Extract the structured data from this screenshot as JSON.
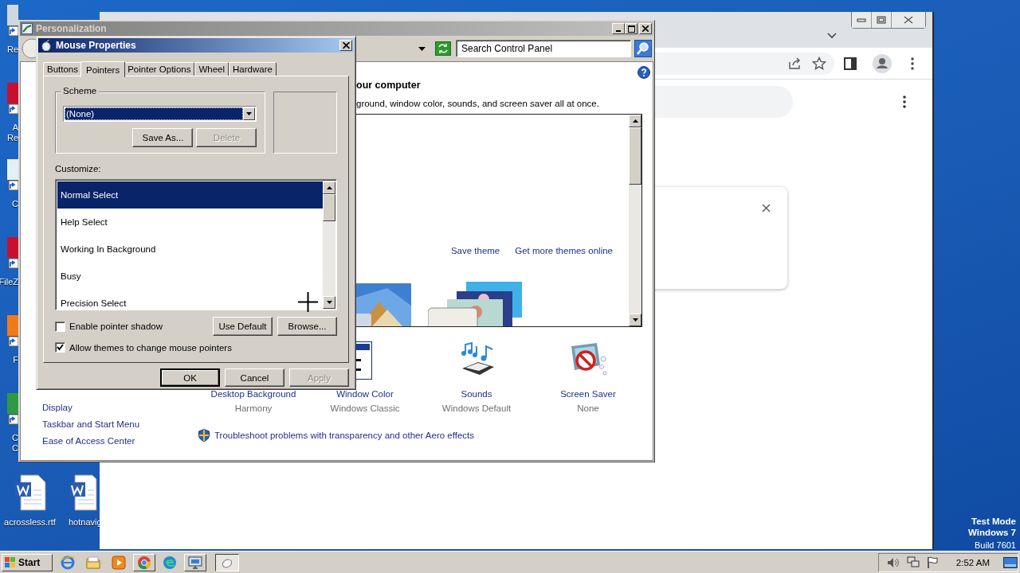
{
  "desktop_icons": [
    {
      "kind": "bin",
      "label": "Re"
    },
    {
      "kind": "app",
      "label": "A\nRe"
    },
    {
      "kind": "plain",
      "label": "C"
    },
    {
      "kind": "app",
      "label": "FileZ"
    },
    {
      "kind": "globe",
      "label": "F"
    },
    {
      "kind": "browser",
      "label": "C\nC"
    }
  ],
  "desktop_files": [
    {
      "label": "acrossless.rtf"
    },
    {
      "label": "hotnavig"
    }
  ],
  "personalization": {
    "title": "Personalization",
    "search": {
      "placeholder": "Search Control Panel"
    },
    "heading": "our computer",
    "description": "ground, window color, sounds, and screen saver all at once.",
    "theme_links": [
      "Save theme",
      "Get more themes online"
    ],
    "settings": [
      {
        "kind": "background",
        "label": "Desktop Background",
        "value": "Harmony"
      },
      {
        "kind": "color",
        "label": "Window Color",
        "value": "Windows Classic"
      },
      {
        "kind": "sounds",
        "label": "Sounds",
        "value": "Windows Default"
      },
      {
        "kind": "screensaver",
        "label": "Screen Saver",
        "value": "None"
      }
    ],
    "see_also": [
      "Display",
      "Taskbar and Start Menu",
      "Ease of Access Center"
    ],
    "troubleshoot_link": "Troubleshoot problems with transparency and other Aero effects"
  },
  "mouse_properties": {
    "title": "Mouse Properties",
    "tabs": [
      {
        "label": "Buttons",
        "selected": false
      },
      {
        "label": "Pointers",
        "selected": true
      },
      {
        "label": "Pointer Options",
        "selected": false
      },
      {
        "label": "Wheel",
        "selected": false
      },
      {
        "label": "Hardware",
        "selected": false
      }
    ],
    "scheme": {
      "label": "Scheme",
      "value": "(None)",
      "buttons": [
        {
          "label": "Save As...",
          "disabled": false
        },
        {
          "label": "Delete",
          "disabled": true
        }
      ]
    },
    "customize_label": "Customize:",
    "pointers": [
      {
        "label": "Normal Select",
        "selected": true
      },
      {
        "label": "Help Select",
        "selected": false
      },
      {
        "label": "Working In Background",
        "selected": false
      },
      {
        "label": "Busy",
        "selected": false
      },
      {
        "label": "Precision Select",
        "selected": false
      }
    ],
    "shadow_checkbox": {
      "label": "Enable pointer shadow",
      "checked": false
    },
    "list_buttons": [
      {
        "label": "Use Default",
        "disabled": false
      },
      {
        "label": "Browse...",
        "disabled": false
      }
    ],
    "themes_checkbox": {
      "label": "Allow themes to change mouse pointers",
      "checked": true
    },
    "dialog_buttons": [
      {
        "label": "OK",
        "disabled": false,
        "default": true
      },
      {
        "label": "Cancel",
        "disabled": false,
        "default": false
      },
      {
        "label": "Apply",
        "disabled": true,
        "default": false
      }
    ]
  },
  "taskbar": {
    "start": "Start",
    "clock": "2:52 AM"
  },
  "test_mode": [
    "Test Mode",
    "Windows 7",
    "Build 7601"
  ]
}
